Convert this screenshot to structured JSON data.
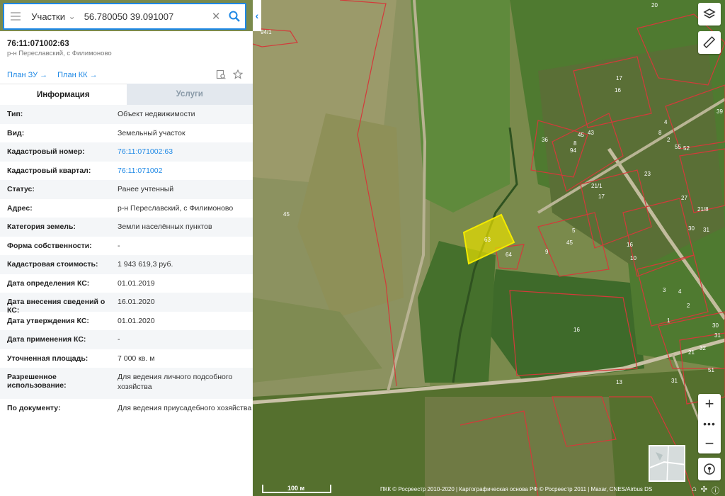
{
  "search": {
    "type_label": "Участки",
    "value": "56.780050 39.091007"
  },
  "object": {
    "title": "76:11:071002:63",
    "subtitle": "р-н Переславский, с Филимоново",
    "plan_zu": "План ЗУ →",
    "plan_kk": "План КК →"
  },
  "tabs": {
    "info": "Информация",
    "services": "Услуги"
  },
  "rows": [
    {
      "label": "Тип:",
      "value": "Объект недвижимости"
    },
    {
      "label": "Вид:",
      "value": "Земельный участок"
    },
    {
      "label": "Кадастровый номер:",
      "value": "76:11:071002:63"
    },
    {
      "label": "Кадастровый квартал:",
      "value": "76:11:071002"
    },
    {
      "label": "Статус:",
      "value": "Ранее учтенный"
    },
    {
      "label": "Адрес:",
      "value": "р-н Переславский, с Филимоново"
    },
    {
      "label": "Категория земель:",
      "value": "Земли населённых пунктов"
    },
    {
      "label": "Форма собственности:",
      "value": "-"
    },
    {
      "label": "Кадастровая стоимость:",
      "value": "1 943 619,3 руб."
    },
    {
      "label": "Дата определения КС:",
      "value": "01.01.2019"
    },
    {
      "label": "Дата внесения сведений о КС:",
      "value": "16.01.2020"
    },
    {
      "label": "Дата утверждения КС:",
      "value": "01.01.2020"
    },
    {
      "label": "Дата применения КС:",
      "value": "-"
    },
    {
      "label": "Уточненная площадь:",
      "value": "7 000 кв. м"
    },
    {
      "label": "Разрешенное использование:",
      "value": "Для ведения личного подсобного хозяйства"
    },
    {
      "label": "По документу:",
      "value": "Для ведения приусадебного хозяйства"
    }
  ],
  "map": {
    "parcel_label": "63",
    "labels": [
      "45",
      "94/1",
      "64",
      "16",
      "13",
      "20",
      "17",
      "16",
      "39",
      "45",
      "43",
      "94",
      "8",
      "36",
      "23",
      "21/1",
      "17",
      "27",
      "21/8",
      "5",
      "9",
      "45",
      "10",
      "30",
      "31",
      "16",
      "3",
      "4",
      "2",
      "1",
      "30",
      "31",
      "32",
      "21",
      "51",
      "31",
      "55",
      "52",
      "4",
      "8",
      "2"
    ],
    "scale_label": "100 м",
    "attribution": "ПКК © Росреестр 2010-2020 | Картографическая основа РФ © Росреестр 2011 | Maxar, CNES/Airbus DS"
  },
  "icons": {
    "menu": "menu-icon",
    "search": "search-icon",
    "clear": "close-icon",
    "layers": "layers-icon",
    "ruler": "ruler-icon",
    "locate": "locate-icon",
    "print": "print-icon",
    "star": "star-icon"
  },
  "colors": {
    "accent": "#1e88e5",
    "parcel_fill": "#e8e000",
    "boundary": "#d33a3a"
  }
}
